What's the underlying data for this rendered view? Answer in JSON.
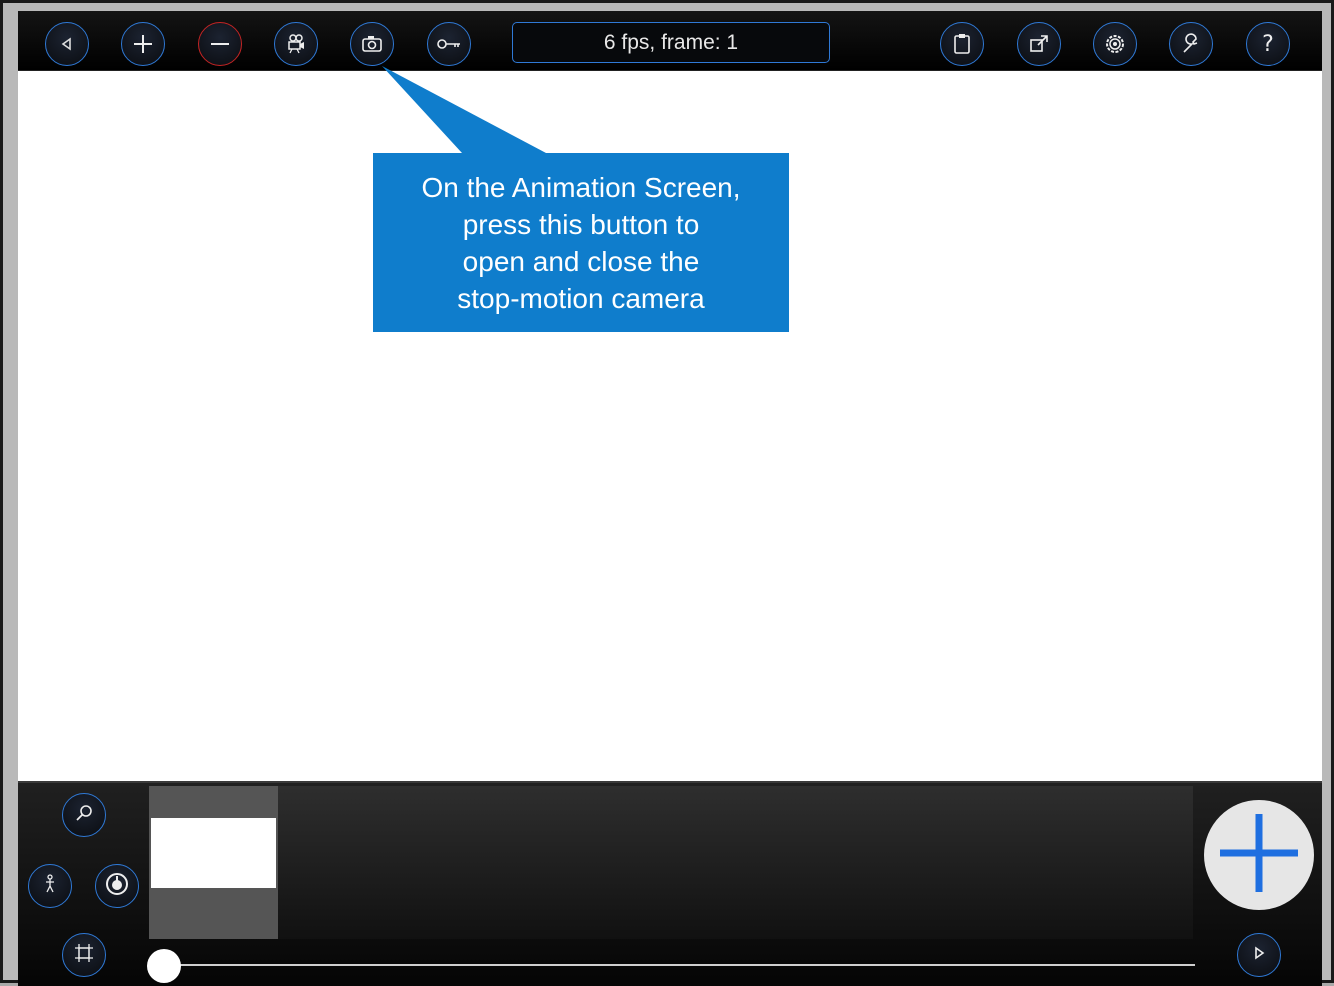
{
  "toolbar": {
    "status_text": "6 fps, frame: 1",
    "buttons": [
      {
        "name": "back-button",
        "icon": "triangle-left-icon"
      },
      {
        "name": "add-frame-top-button",
        "icon": "plus-icon"
      },
      {
        "name": "delete-frame-button",
        "icon": "minus-icon"
      },
      {
        "name": "video-camera-button",
        "icon": "video-camera-icon"
      },
      {
        "name": "stop-motion-camera-button",
        "icon": "camera-icon"
      },
      {
        "name": "key-button",
        "icon": "key-icon"
      },
      {
        "name": "clipboard-button",
        "icon": "clipboard-icon"
      },
      {
        "name": "export-button",
        "icon": "export-icon"
      },
      {
        "name": "settings-button",
        "icon": "gear-icon"
      },
      {
        "name": "tools-button",
        "icon": "wrench-icon"
      },
      {
        "name": "help-button",
        "icon": "question-icon"
      }
    ]
  },
  "callout": {
    "text_lines": [
      "On the Animation Screen,",
      "press this button to",
      "open and close the",
      "stop-motion camera"
    ],
    "color": "#0f7dcc"
  },
  "timeline": {
    "buttons": [
      {
        "name": "zoom-button",
        "icon": "magnifier-icon"
      },
      {
        "name": "figure-button",
        "icon": "stick-figure-icon"
      },
      {
        "name": "onion-skin-button",
        "icon": "dial-icon"
      },
      {
        "name": "fit-button",
        "icon": "frame-fit-icon"
      },
      {
        "name": "play-button",
        "icon": "play-icon"
      },
      {
        "name": "add-frame-button",
        "icon": "big-plus-icon"
      }
    ],
    "current_frame": 1
  },
  "colors": {
    "accent": "#2f79d6",
    "danger": "#c42424",
    "callout": "#0f7dcc"
  }
}
